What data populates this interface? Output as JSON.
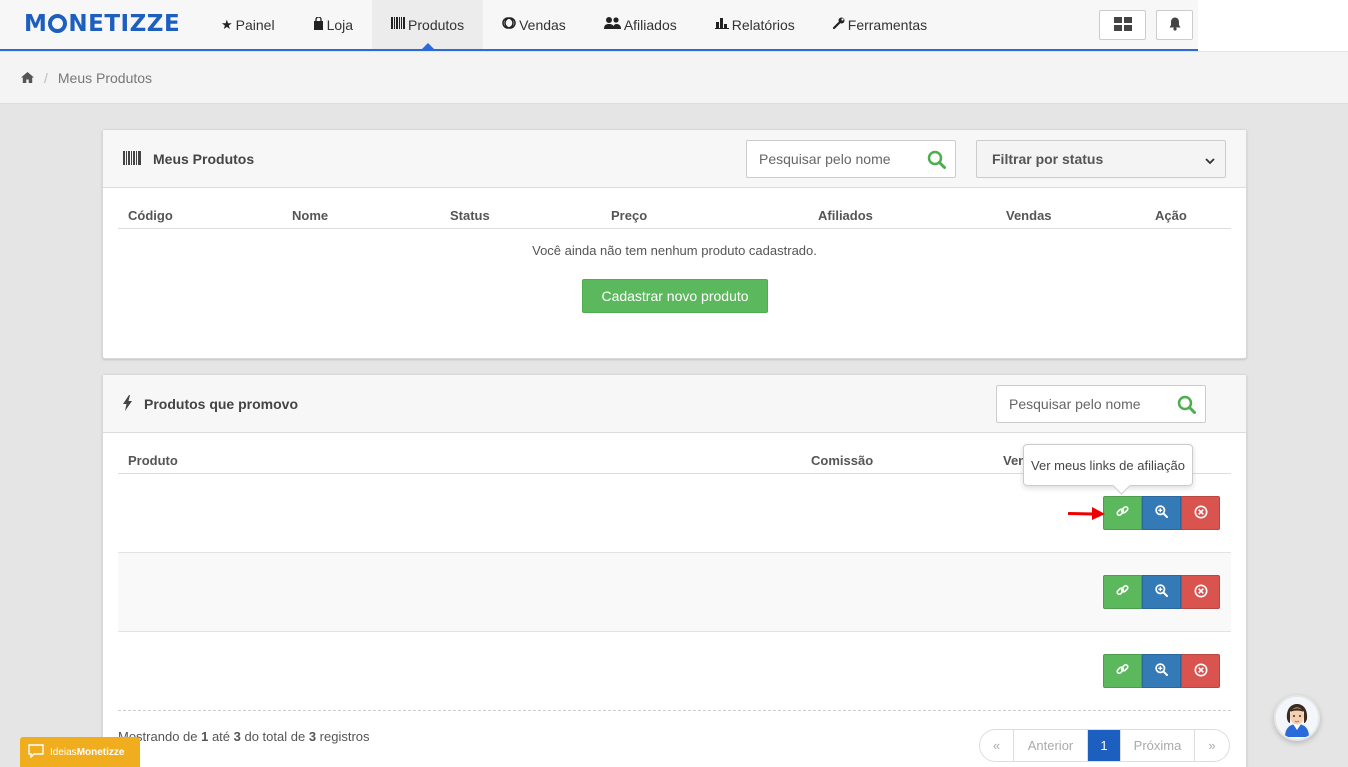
{
  "brand": {
    "logo_text_left": "M",
    "logo_text_right": "NETIZZE",
    "color": "#1d5fbf"
  },
  "nav": {
    "items": [
      {
        "label": "Painel",
        "icon": "star-icon"
      },
      {
        "label": "Loja",
        "icon": "shopping-bag-icon"
      },
      {
        "label": "Produtos",
        "icon": "barcode-icon"
      },
      {
        "label": "Vendas",
        "icon": "money-icon"
      },
      {
        "label": "Afiliados",
        "icon": "users-icon"
      },
      {
        "label": "Relatórios",
        "icon": "bar-chart-icon"
      },
      {
        "label": "Ferramentas",
        "icon": "wrench-icon"
      }
    ],
    "active": "Produtos"
  },
  "breadcrumb": {
    "home_icon": "home-icon",
    "current": "Meus Produtos"
  },
  "my_products": {
    "title": "Meus Produtos",
    "search_placeholder": "Pesquisar pelo nome",
    "filter_label": "Filtrar por status",
    "columns": [
      "Código",
      "Nome",
      "Status",
      "Preço",
      "Afiliados",
      "Vendas",
      "Ação"
    ],
    "empty_message": "Você ainda não tem nenhum produto cadastrado.",
    "new_product_button": "Cadastrar novo produto"
  },
  "promoted": {
    "title": "Produtos que promovo",
    "search_placeholder": "Pesquisar pelo nome",
    "columns": [
      "Produto",
      "Comissão",
      "Ven"
    ],
    "rows": [
      {},
      {},
      {}
    ],
    "tooltip": "Ver meus links de afiliação",
    "info_prefix": "Mostrando de ",
    "info_from": "1",
    "info_mid1": " até ",
    "info_to": "3",
    "info_mid2": " do total de ",
    "info_total": "3",
    "info_suffix": " registros"
  },
  "pagination": {
    "first": "«",
    "prev": "Anterior",
    "current": "1",
    "next": "Próxima",
    "last": "»"
  },
  "ideas_widget": {
    "label_prefix": "Ideias ",
    "label_brand": "Monetizze"
  },
  "colors": {
    "green": "#5cb85c",
    "blue": "#337ab7",
    "red": "#d9534f",
    "accent": "#2a6ad9",
    "ideas": "#f0ad1e"
  }
}
